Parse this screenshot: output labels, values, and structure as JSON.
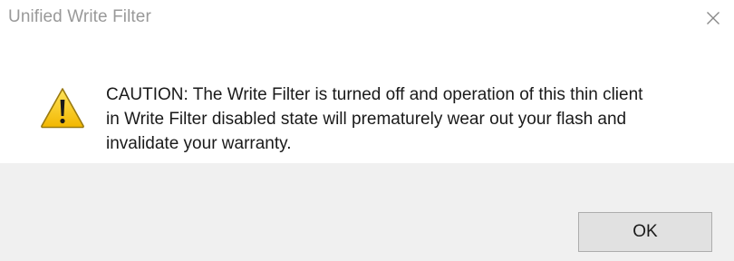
{
  "dialog": {
    "title": "Unified Write Filter",
    "message_lines": [
      "CAUTION: The Write Filter is turned off and operation of this thin client",
      "in Write Filter disabled state will prematurely wear out your flash and",
      "invalidate your warranty."
    ],
    "ok_label": "OK",
    "icon": "warning-icon",
    "close_icon": "close-icon"
  },
  "colors": {
    "footer_bg": "#f0f0f0",
    "button_bg": "#e1e1e1",
    "button_border": "#adadad",
    "title_text": "#999999",
    "warning_yellow": "#f5c400"
  }
}
